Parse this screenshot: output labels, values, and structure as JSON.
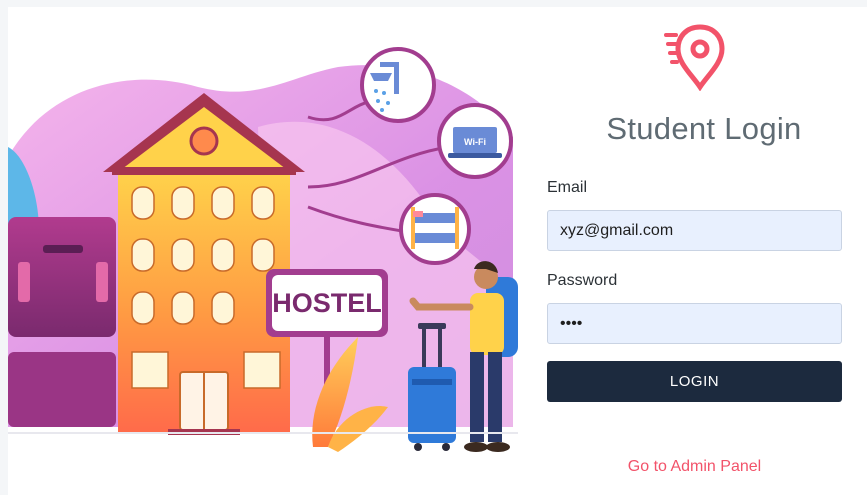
{
  "illustration": {
    "sign_text": "HOSTEL",
    "wifi_text": "Wi-Fi"
  },
  "login": {
    "title": "Student Login",
    "email_label": "Email",
    "email_value": "xyz@gmail.com",
    "password_label": "Password",
    "password_value": "1234",
    "login_button": "LOGIN",
    "admin_link": "Go to Admin Panel"
  },
  "colors": {
    "accent": "#f2536a",
    "button": "#1c2a3e",
    "input_bg": "#e8f0fe",
    "title": "#5f6b73"
  },
  "icons": {
    "logo": "location-pin-icon"
  }
}
